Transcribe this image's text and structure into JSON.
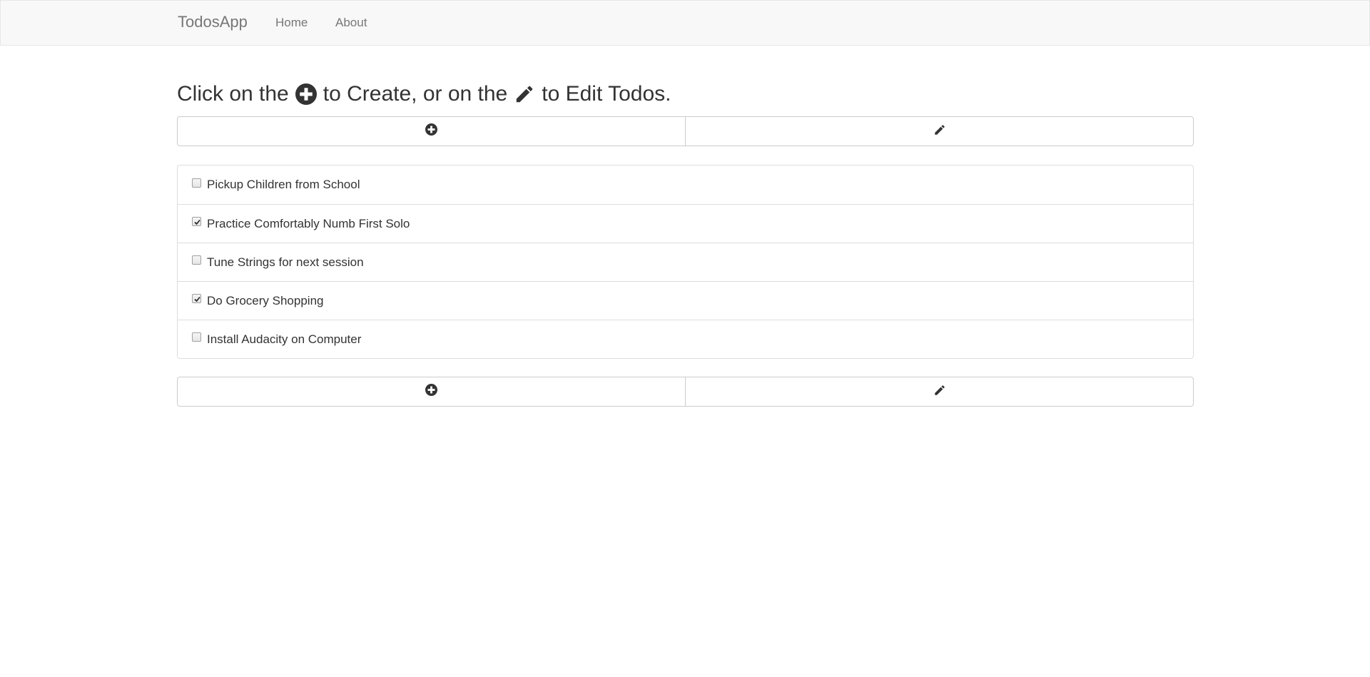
{
  "navbar": {
    "brand": "TodosApp",
    "links": [
      {
        "label": "Home"
      },
      {
        "label": "About"
      }
    ]
  },
  "heading": {
    "part1": "Click on the",
    "part2": "to Create, or on the",
    "part3": "to Edit Todos.",
    "create_icon": "plus-circle-icon",
    "edit_icon": "pencil-icon"
  },
  "toolbar": {
    "create_icon": "plus-circle-icon",
    "edit_icon": "pencil-icon"
  },
  "todos": [
    {
      "label": "Pickup Children from School",
      "checked": false
    },
    {
      "label": "Practice Comfortably Numb First Solo",
      "checked": true
    },
    {
      "label": "Tune Strings for next session",
      "checked": false
    },
    {
      "label": "Do Grocery Shopping",
      "checked": true
    },
    {
      "label": "Install Audacity on Computer",
      "checked": false
    }
  ],
  "colors": {
    "navbar_bg": "#f8f8f8",
    "text": "#333333",
    "muted": "#777777",
    "border": "#dddddd"
  }
}
